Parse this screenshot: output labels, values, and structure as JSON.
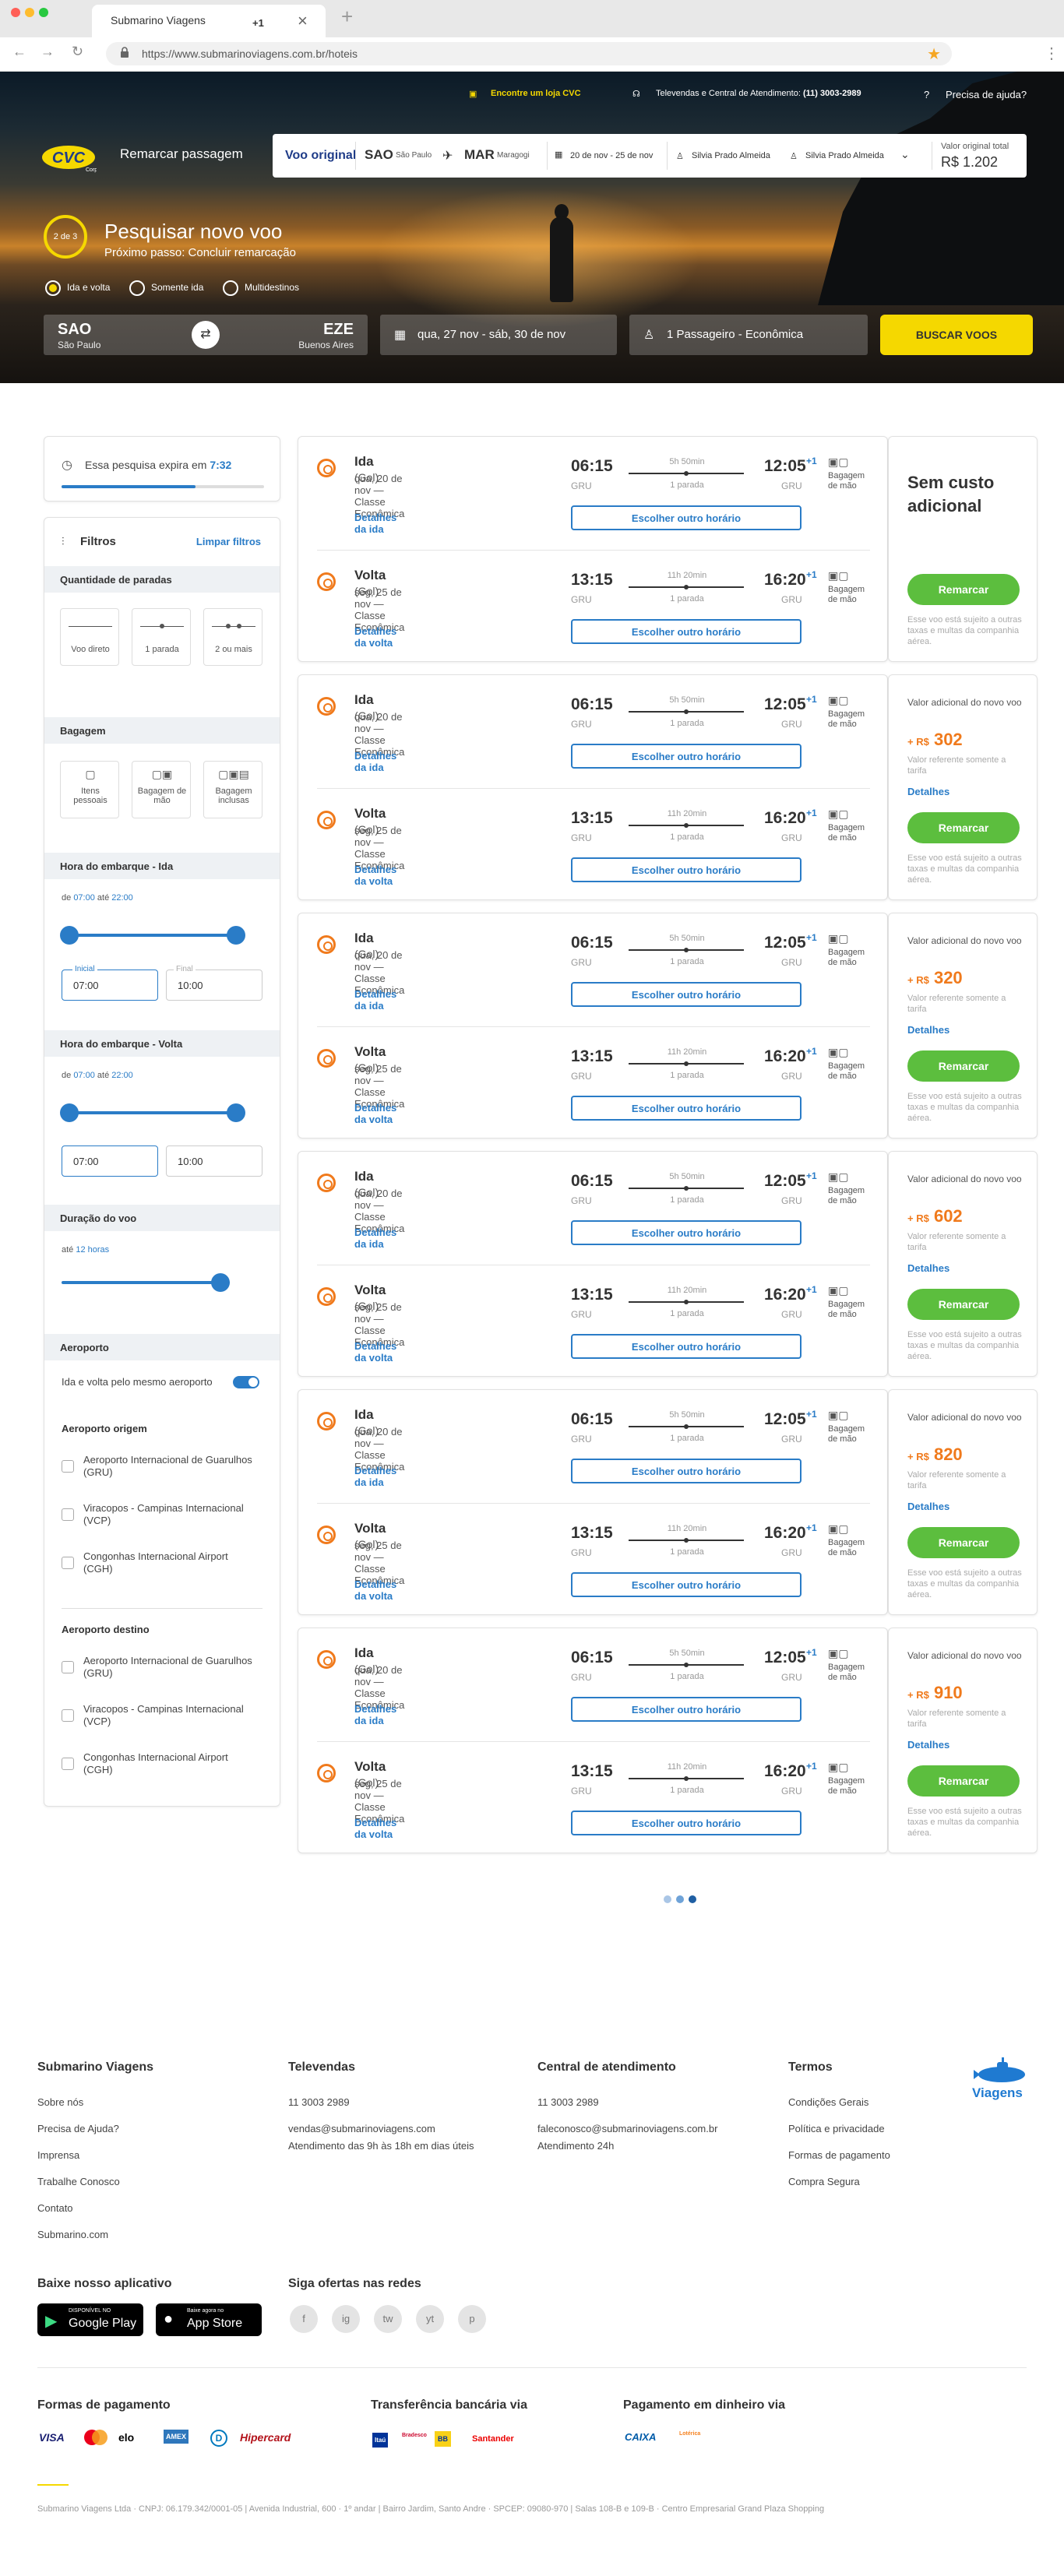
{
  "browser": {
    "tab_title": "Submarino Viagens",
    "tab_badge": "+1",
    "url": "https://www.submarinoviagens.com.br/hoteis"
  },
  "hero": {
    "store_link": "Encontre um loja CVC",
    "phone_text": "Televendas e Central de Atendimento:",
    "phone_number": "(11) 3003-2989",
    "help": "Precisa de ajuda?",
    "logo_text": "CVC",
    "logo_sub": "Corp",
    "remarcar_title": "Remarcar passagem",
    "original_label": "Voo original",
    "origin_code": "SAO",
    "origin_city": "São Paulo",
    "dest_code": "MAR",
    "dest_city": "Maragogi",
    "dates": "20 de nov - 25 de nov",
    "passenger1": "Silvia Prado Almeida",
    "passenger2": "Silvia Prado Almeida",
    "original_total_label": "Valor original total",
    "original_total": "R$ 1.202",
    "step": "2 de 3",
    "page_title": "Pesquisar novo voo",
    "page_subtitle": "Próximo passo: Concluir remarcação",
    "trip_types": [
      "Ida e volta",
      "Somente ida",
      "Multidestinos"
    ],
    "search_from_code": "SAO",
    "search_from_city": "São Paulo",
    "search_to_code": "EZE",
    "search_to_city": "Buenos Aires",
    "search_dates": "qua, 27 nov - sáb, 30 de nov",
    "search_pax": "1 Passageiro - Econômica",
    "search_button": "BUSCAR VOOS"
  },
  "sidebar": {
    "expire_text": "Essa pesquisa expira em",
    "expire_time": "7:32",
    "expire_progress": 0.66,
    "filters_title": "Filtros",
    "clear_filters": "Limpar filtros",
    "stops_title": "Quantidade de paradas",
    "stops": [
      "Voo direto",
      "1 parada",
      "2 ou mais"
    ],
    "baggage_title": "Bagagem",
    "baggage": [
      "Itens pessoais",
      "Bagagem de mão",
      "Bagagem inclusas"
    ],
    "depart_title": "Hora do embarque - Ida",
    "depart_from_word": "de",
    "depart_from": "07:00",
    "depart_to_word": "até",
    "depart_to": "22:00",
    "depart_initial_label": "Inicial",
    "depart_final_label": "Final",
    "depart_input_start": "07:00",
    "depart_input_end": "10:00",
    "return_title": "Hora do embarque - Volta",
    "return_from_word": "de",
    "return_from": "07:00",
    "return_to_word": "até",
    "return_to": "22:00",
    "return_input_start": "07:00",
    "return_input_end": "10:00",
    "duration_title": "Duração do voo",
    "duration_word": "até",
    "duration_value": "12 horas",
    "airport_title": "Aeroporto",
    "same_airport": "Ida e volta pelo mesmo aeroporto",
    "origin_airport_title": "Aeroporto origem",
    "origin_airports": [
      "Aeroporto Internacional de Guarulhos (GRU)",
      "Viracopos - Campinas Internacional (VCP)",
      "Congonhas Internacional Airport (CGH)"
    ],
    "dest_airport_title": "Aeroporto destino",
    "dest_airports": [
      "Aeroporto Internacional de Guarulhos (GRU)",
      "Viracopos - Campinas Internacional (VCP)",
      "Congonhas Internacional Airport (CGH)"
    ]
  },
  "results": {
    "ida": {
      "label": "Ida",
      "airline": "(Gol)",
      "date": "qua, 20 de nov — Classe Econômica",
      "details": "Detalhes da ida",
      "dep": "06:15",
      "arr": "12:05",
      "plus": "+1",
      "from": "GRU",
      "to": "GRU",
      "duration": "5h 50min",
      "stops": "1 parada",
      "button": "Escolher outro horário",
      "bag": "Bagagem de mão"
    },
    "volta": {
      "label": "Volta",
      "airline": "(Gol)",
      "date": "seg, 25 de nov — Classe Econômica",
      "details": "Detalhes da volta",
      "dep": "13:15",
      "arr": "16:20",
      "plus": "+1",
      "from": "GRU",
      "to": "GRU",
      "duration": "11h 20min",
      "stops": "1 parada",
      "button": "Escolher outro horário",
      "bag": "Bagagem de mão"
    },
    "first_price_title": "Sem custo adicional",
    "add_label": "Valor adicional do novo voo",
    "currency_prefix": "+ R$",
    "prices": [
      "302",
      "320",
      "602",
      "820",
      "910"
    ],
    "ref_text": "Valor referente somente a tarifa",
    "details": "Detalhes",
    "button": "Remarcar",
    "note": "Esse voo está sujeito a outras taxas e multas da companhia aérea."
  },
  "footer": {
    "col1_title": "Submarino Viagens",
    "col1_links": [
      "Sobre nós",
      "Precisa de Ajuda?",
      "Imprensa",
      "Trabalhe Conosco",
      "Contato",
      "Submarino.com"
    ],
    "col2_title": "Televendas",
    "col2_lines": [
      "11 3003 2989",
      "vendas@submarinoviagens.com",
      "Atendimento das 9h às 18h em dias úteis"
    ],
    "col3_title": "Central de atendimento",
    "col3_lines": [
      "11 3003 2989",
      "faleconosco@submarinoviagens.com.br",
      "Atendimento 24h"
    ],
    "col4_title": "Termos",
    "col4_links": [
      "Condições Gerais",
      "Política e privacidade",
      "Formas de pagamento",
      "Compra Segura"
    ],
    "brand": "Viagens",
    "app_title": "Baixe nosso aplicativo",
    "gp_small": "DISPONÍVEL NO",
    "gp_big": "Google Play",
    "as_small": "Baixe agora no",
    "as_big": "App Store",
    "social_title": "Siga ofertas nas redes",
    "social": [
      "f",
      "ig",
      "tw",
      "yt",
      "p"
    ],
    "payment_title": "Formas de pagamento",
    "payment_logos": [
      "VISA",
      "MC",
      "elo",
      "AMEX",
      "D",
      "Hipercard"
    ],
    "transfer_title": "Transferência bancária via",
    "transfer_logos": [
      "Itaú",
      "Bradesco",
      "BB",
      "Santander"
    ],
    "cash_title": "Pagamento em dinheiro via",
    "cash_logos": [
      "CAIXA",
      "Lotérica"
    ],
    "legal": "Submarino Viagens Ltda  ·  CNPJ: 06.179.342/0001-05 | Avenida Industrial, 600  ·  1º andar | Bairro Jardim, Santo Andre · SPCEP: 09080-970  |  Salas 108-B e 109-B  ·  Centro Empresarial Grand Plaza Shopping"
  }
}
